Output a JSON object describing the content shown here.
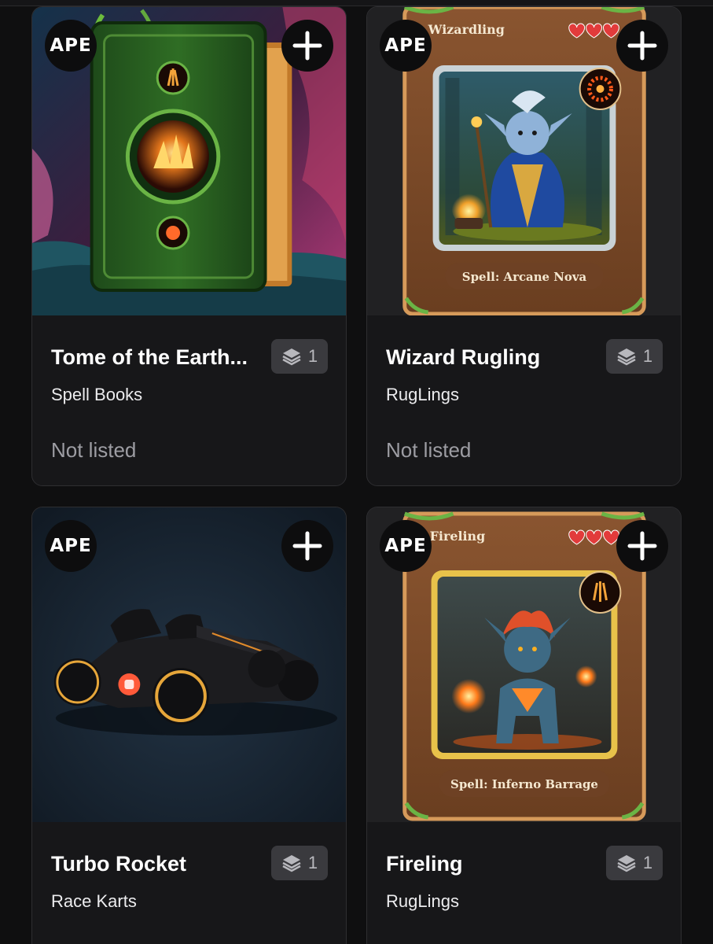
{
  "chain_badge": "APE",
  "cards": [
    {
      "name": "Tome of the Earth...",
      "collection": "Spell Books",
      "quantity": "1",
      "status": "Not listed",
      "artwork": "green-spellbook",
      "art_text": {}
    },
    {
      "name": "Wizard Rugling",
      "collection": "RugLings",
      "quantity": "1",
      "status": "Not listed",
      "artwork": "wizard-rugling-card",
      "art_text": {
        "card_name": "Wizardling",
        "spell": "Spell: Arcane Nova",
        "hearts": 3
      }
    },
    {
      "name": "Turbo Rocket",
      "collection": "Race Karts",
      "quantity": "1",
      "status": "",
      "artwork": "black-race-kart",
      "art_text": {}
    },
    {
      "name": "Fireling",
      "collection": "RugLings",
      "quantity": "1",
      "status": "",
      "artwork": "fireling-card",
      "art_text": {
        "card_name": "Fireling",
        "spell": "Spell: Inferno Barrage",
        "hearts": 3
      }
    }
  ],
  "colors": {
    "page_bg": "#0f0f10",
    "card_bg": "#171719",
    "card_border": "#2e2e31",
    "quantity_badge_bg": "#3a3a3e",
    "muted_text": "#9d9da3"
  },
  "icons": {
    "add": "plus-icon",
    "quantity": "layers-stack-icon"
  }
}
